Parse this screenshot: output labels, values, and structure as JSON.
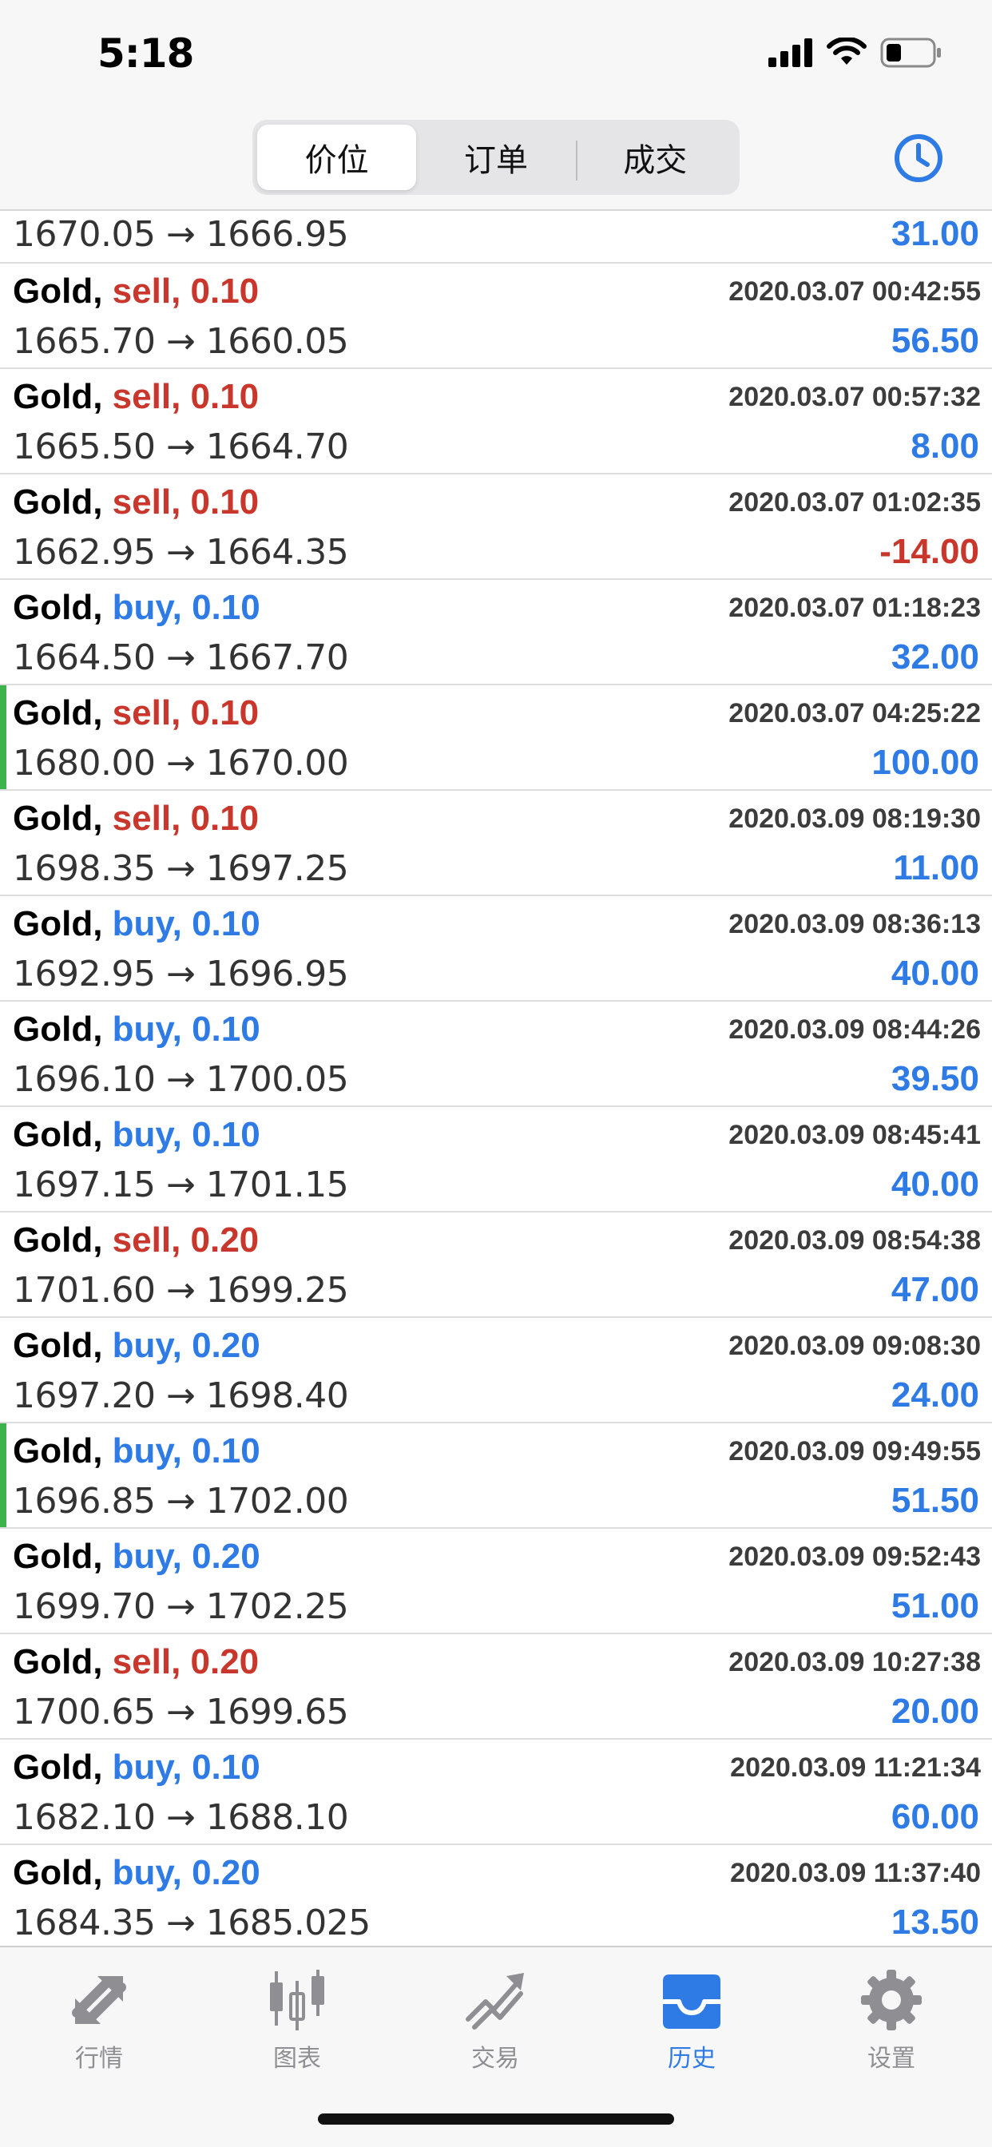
{
  "status_bar": {
    "time": "5:18"
  },
  "segmented_control": {
    "tabs": [
      {
        "label": "价位",
        "active": true
      },
      {
        "label": "订单",
        "active": false
      },
      {
        "label": "成交",
        "active": false
      }
    ]
  },
  "first_line": {
    "prices": "1670.05 → 1666.95",
    "profit": "31.00"
  },
  "deals": [
    {
      "symbol": "Gold,",
      "side": "sell, 0.10",
      "type": "sell",
      "time": "2020.03.07 00:42:55",
      "prices": "1665.70 → 1660.05",
      "profit": "56.50",
      "marked": false
    },
    {
      "symbol": "Gold,",
      "side": "sell, 0.10",
      "type": "sell",
      "time": "2020.03.07 00:57:32",
      "prices": "1665.50 → 1664.70",
      "profit": "8.00",
      "marked": false
    },
    {
      "symbol": "Gold,",
      "side": "sell, 0.10",
      "type": "sell",
      "time": "2020.03.07 01:02:35",
      "prices": "1662.95 → 1664.35",
      "profit": "-14.00",
      "marked": false
    },
    {
      "symbol": "Gold,",
      "side": "buy, 0.10",
      "type": "buy",
      "time": "2020.03.07 01:18:23",
      "prices": "1664.50 → 1667.70",
      "profit": "32.00",
      "marked": false
    },
    {
      "symbol": "Gold,",
      "side": "sell, 0.10",
      "type": "sell",
      "time": "2020.03.07 04:25:22",
      "prices": "1680.00 → 1670.00",
      "profit": "100.00",
      "marked": true
    },
    {
      "symbol": "Gold,",
      "side": "sell, 0.10",
      "type": "sell",
      "time": "2020.03.09 08:19:30",
      "prices": "1698.35 → 1697.25",
      "profit": "11.00",
      "marked": false
    },
    {
      "symbol": "Gold,",
      "side": "buy, 0.10",
      "type": "buy",
      "time": "2020.03.09 08:36:13",
      "prices": "1692.95 → 1696.95",
      "profit": "40.00",
      "marked": false
    },
    {
      "symbol": "Gold,",
      "side": "buy, 0.10",
      "type": "buy",
      "time": "2020.03.09 08:44:26",
      "prices": "1696.10 → 1700.05",
      "profit": "39.50",
      "marked": false
    },
    {
      "symbol": "Gold,",
      "side": "buy, 0.10",
      "type": "buy",
      "time": "2020.03.09 08:45:41",
      "prices": "1697.15 → 1701.15",
      "profit": "40.00",
      "marked": false
    },
    {
      "symbol": "Gold,",
      "side": "sell, 0.20",
      "type": "sell",
      "time": "2020.03.09 08:54:38",
      "prices": "1701.60 → 1699.25",
      "profit": "47.00",
      "marked": false
    },
    {
      "symbol": "Gold,",
      "side": "buy, 0.20",
      "type": "buy",
      "time": "2020.03.09 09:08:30",
      "prices": "1697.20 → 1698.40",
      "profit": "24.00",
      "marked": false
    },
    {
      "symbol": "Gold,",
      "side": "buy, 0.10",
      "type": "buy",
      "time": "2020.03.09 09:49:55",
      "prices": "1696.85 → 1702.00",
      "profit": "51.50",
      "marked": true
    },
    {
      "symbol": "Gold,",
      "side": "buy, 0.20",
      "type": "buy",
      "time": "2020.03.09 09:52:43",
      "prices": "1699.70 → 1702.25",
      "profit": "51.00",
      "marked": false
    },
    {
      "symbol": "Gold,",
      "side": "sell, 0.20",
      "type": "sell",
      "time": "2020.03.09 10:27:38",
      "prices": "1700.65 → 1699.65",
      "profit": "20.00",
      "marked": false
    },
    {
      "symbol": "Gold,",
      "side": "buy, 0.10",
      "type": "buy",
      "time": "2020.03.09 11:21:34",
      "prices": "1682.10 → 1688.10",
      "profit": "60.00",
      "marked": false
    },
    {
      "symbol": "Gold,",
      "side": "buy, 0.20",
      "type": "buy",
      "time": "2020.03.09 11:37:40",
      "prices": "1684.35 → 1685.025",
      "profit": "13.50",
      "marked": false
    }
  ],
  "tab_bar": {
    "tabs": [
      {
        "label": "行情",
        "icon": "quotes-icon",
        "active": false
      },
      {
        "label": "图表",
        "icon": "chart-icon",
        "active": false
      },
      {
        "label": "交易",
        "icon": "trade-icon",
        "active": false
      },
      {
        "label": "历史",
        "icon": "history-icon",
        "active": true
      },
      {
        "label": "设置",
        "icon": "settings-icon",
        "active": false
      }
    ]
  },
  "colors": {
    "accent": "#2f7be5",
    "sell": "#c9372c",
    "marker": "#3cb44b"
  }
}
